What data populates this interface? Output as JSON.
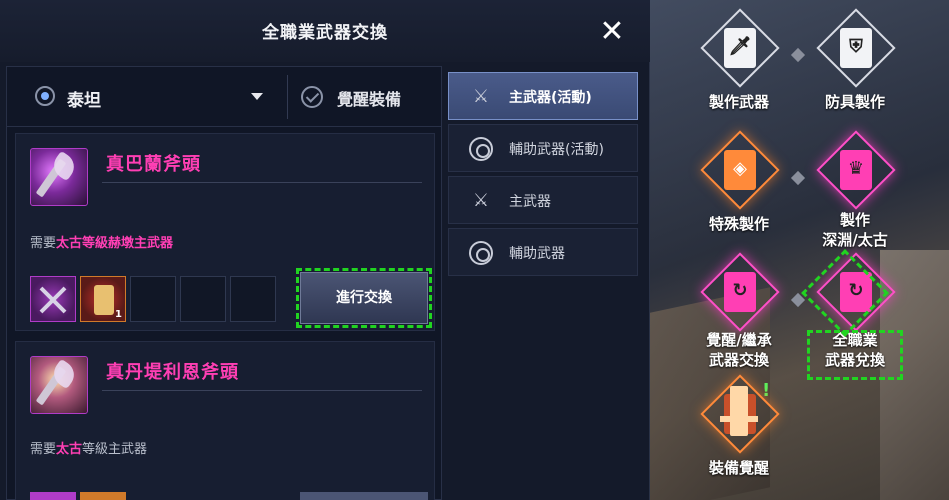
{
  "dialog": {
    "title": "全職業武器交換",
    "close_label": "✕"
  },
  "filter": {
    "class_name": "泰坦",
    "awaken_label": "覺醒裝備"
  },
  "items": [
    {
      "name": "真巴蘭斧頭",
      "req_prefix": "需要",
      "req_highlight": "太古等級赫墩主武器",
      "req_suffix": "",
      "material_count": "1",
      "exchange_label": "進行交換"
    },
    {
      "name": "真丹堤利恩斧頭",
      "req_prefix": "需要",
      "req_highlight": "太古",
      "req_suffix": "等級主武器"
    }
  ],
  "tabs": [
    {
      "label": "主武器(活動)",
      "icon": "crossed-swords-icon",
      "active": true
    },
    {
      "label": "輔助武器(活動)",
      "icon": "ring-icon",
      "active": false
    },
    {
      "label": "主武器",
      "icon": "crossed-swords-icon",
      "active": false
    },
    {
      "label": "輔助武器",
      "icon": "ring-icon",
      "active": false
    }
  ],
  "craft_menu": {
    "weapon_craft": "製作武器",
    "armor_craft": "防具製作",
    "special_craft": "特殊製作",
    "abyss_craft_line1": "製作",
    "abyss_craft_line2": "深淵/太古",
    "awaken_inherit_line1": "覺醒/繼承",
    "awaken_inherit_line2": "武器交換",
    "all_class_line1": "全職業",
    "all_class_line2": "武器兌換",
    "gear_awaken": "裝備覺醒",
    "alert_mark": "!"
  },
  "colors": {
    "highlight_pink": "#ff3fb4",
    "active_tab": "#4a5b8a",
    "annotation_green": "#21d421"
  }
}
